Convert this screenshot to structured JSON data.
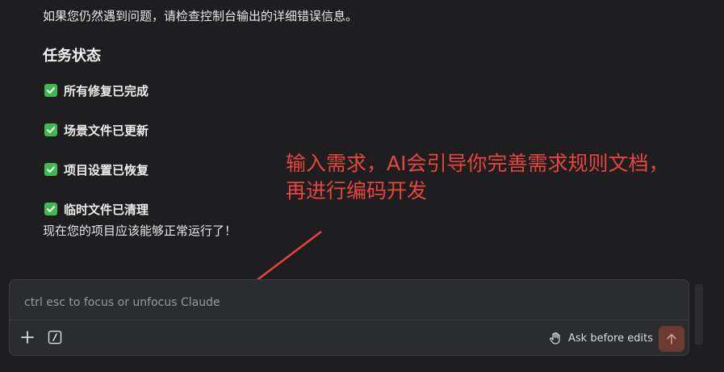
{
  "messages": {
    "intro": "如果您仍然遇到问题，请检查控制台输出的详细错误信息。",
    "section_title": "任务状态",
    "status_items": [
      {
        "label": "所有修复已完成"
      },
      {
        "label": "场景文件已更新"
      },
      {
        "label": "项目设置已恢复"
      },
      {
        "label": "临时文件已清理"
      }
    ],
    "outro": "现在您的项目应该能够正常运行了！"
  },
  "annotation": {
    "line1": "输入需求，AI会引导你完善需求规则文档，",
    "line2": "再进行编码开发",
    "color": "#e8453c"
  },
  "composer": {
    "placeholder": "ctrl esc to focus or unfocus Claude",
    "value": "",
    "add_icon": "plus-icon",
    "slash_icon": "slash-command-icon",
    "mode_label": "Ask before edits",
    "mode_icon": "hand-icon",
    "send_icon": "arrow-up-icon",
    "send_color": "#6b3a30"
  },
  "colors": {
    "background": "#1e1e20",
    "check": "#3fb950"
  }
}
